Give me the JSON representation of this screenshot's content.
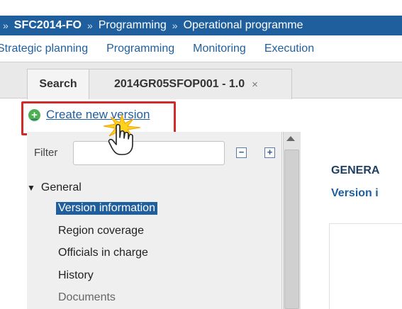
{
  "breadcrumb": {
    "items": [
      "SFC2014-FO",
      "Programming",
      "Operational programme"
    ],
    "separator": "»"
  },
  "main_nav": {
    "items": [
      "Strategic planning",
      "Programming",
      "Monitoring",
      "Execution"
    ]
  },
  "tabs": {
    "search_label": "Search",
    "record_label": "2014GR05SFOP001 - 1.0",
    "close_glyph": "×"
  },
  "toolbar": {
    "create_label": "Create new version",
    "icon": "plus-circle-icon"
  },
  "tree": {
    "filter_label": "Filter",
    "filter_value": "",
    "collapse_glyph": "−",
    "expand_glyph": "+",
    "group_label": "General",
    "group_arrow": "▼",
    "items": [
      "Version information",
      "Region coverage",
      "Officials in charge",
      "History",
      "Documents"
    ],
    "selected_index": 0
  },
  "content": {
    "section_title": "GENERA",
    "section_subtitle": "Version i"
  },
  "colors": {
    "brand_blue": "#1f5f9e",
    "highlight_red": "#d02a2a",
    "plus_green": "#4caf50"
  }
}
